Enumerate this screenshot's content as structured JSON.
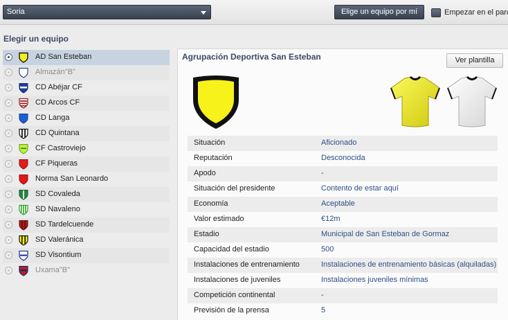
{
  "toolbar": {
    "region_value": "Soria",
    "pick_team_label": "Elige un equipo por mí",
    "start_label": "Empezar en el parc"
  },
  "left_panel": {
    "title": "Elegir un equipo",
    "teams": [
      {
        "name": "AD San Esteban",
        "selected": true,
        "reserve": false
      },
      {
        "name": "Almazán\"B\"",
        "selected": false,
        "reserve": true
      },
      {
        "name": "CD Abéjar CF",
        "selected": false,
        "reserve": false
      },
      {
        "name": "CD Arcos CF",
        "selected": false,
        "reserve": false
      },
      {
        "name": "CD Langa",
        "selected": false,
        "reserve": false
      },
      {
        "name": "CD Quintana",
        "selected": false,
        "reserve": false
      },
      {
        "name": "CF Castroviejo",
        "selected": false,
        "reserve": false
      },
      {
        "name": "CF Piqueras",
        "selected": false,
        "reserve": false
      },
      {
        "name": "Norma San Leonardo",
        "selected": false,
        "reserve": false
      },
      {
        "name": "SD Covaleda",
        "selected": false,
        "reserve": false
      },
      {
        "name": "SD Navaleno",
        "selected": false,
        "reserve": false
      },
      {
        "name": "SD Tardelcuende",
        "selected": false,
        "reserve": false
      },
      {
        "name": "SD Valeránica",
        "selected": false,
        "reserve": false
      },
      {
        "name": "SD Visontium",
        "selected": false,
        "reserve": false
      },
      {
        "name": "Uxama\"B\"",
        "selected": false,
        "reserve": true
      }
    ]
  },
  "detail": {
    "club_name": "Agrupación Deportiva San Esteban",
    "squad_button": "Ver plantilla",
    "rows": [
      {
        "label": "Situación",
        "value": "Aficionado"
      },
      {
        "label": "Reputación",
        "value": "Desconocida"
      },
      {
        "label": "Apodo",
        "value": "-"
      },
      {
        "label": "Situación del presidente",
        "value": "Contento de estar aquí"
      },
      {
        "label": "Economía",
        "value": "Aceptable"
      },
      {
        "label": "Valor estimado",
        "value": "€12m"
      },
      {
        "label": "Estadio",
        "value": "Municipal de San Esteban de Gormaz"
      },
      {
        "label": "Capacidad del estadio",
        "value": "500"
      },
      {
        "label": "Instalaciones de entrenamiento",
        "value": "Instalaciones de entrenamiento básicas (alquiladas)"
      },
      {
        "label": "Instalaciones de juveniles",
        "value": "Instalaciones juveniles mínimas"
      },
      {
        "label": "Competición continental",
        "value": "-"
      },
      {
        "label": "Previsión de la prensa",
        "value": "5"
      }
    ]
  },
  "colors": {
    "accent_title": "#3b4a63",
    "value_text": "#2d4f86",
    "selected_row": "#c7d3e0",
    "home_kit": "#f1ee2a",
    "away_kit": "#ffffff"
  }
}
